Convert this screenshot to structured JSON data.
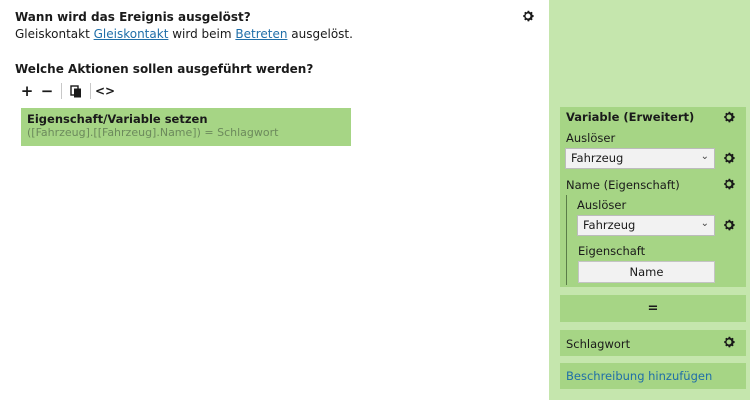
{
  "trigger": {
    "question": "Wann wird das Ereignis ausgelöst?",
    "sentence_prefix": "Gleiskontakt ",
    "link_contact": "Gleiskontakt",
    "sentence_mid": " wird beim ",
    "link_event": "Betreten",
    "sentence_suffix": " ausgelöst."
  },
  "actions": {
    "question": "Welche Aktionen sollen ausgeführt werden?",
    "toolbar": {
      "add": "+",
      "remove": "−",
      "code": "<>"
    },
    "items": [
      {
        "title": "Eigenschaft/Variable setzen",
        "expression": "([Fahrzeug].[[Fahrzeug].Name]) = Schlagwort"
      }
    ]
  },
  "panel": {
    "variable_card": {
      "title": "Variable (Erweitert)",
      "trigger_label": "Auslöser",
      "trigger_value": "Fahrzeug",
      "name_label": "Name (Eigenschaft)",
      "inner_trigger_label": "Auslöser",
      "inner_trigger_value": "Fahrzeug",
      "property_label": "Eigenschaft",
      "property_value": "Name"
    },
    "operator": "=",
    "value_card": {
      "label": "Schlagwort"
    },
    "description_link": "Beschreibung hinzufügen"
  },
  "icons": {
    "settings": "gear-icon",
    "dropdown": "chevron-down-icon",
    "copy": "copy-icon"
  },
  "colors": {
    "panel_bg": "#c5e6ad",
    "card_bg": "#a6d585",
    "link": "#1f6ea8"
  }
}
